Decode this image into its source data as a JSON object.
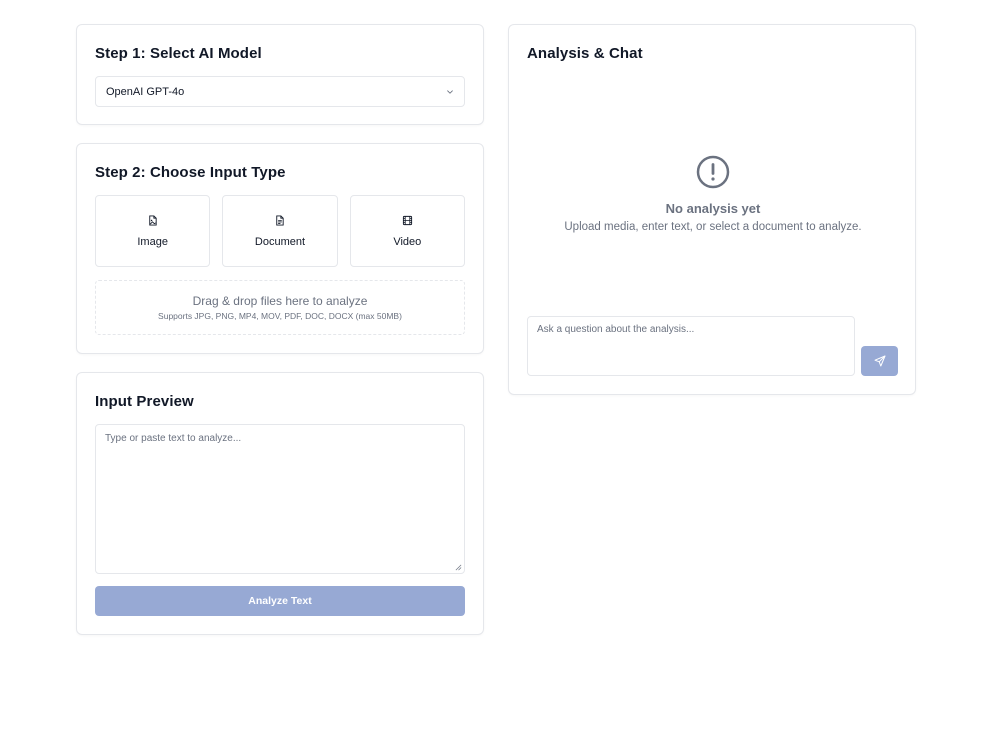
{
  "step1": {
    "title": "Step 1: Select AI Model",
    "selected_model": "OpenAI GPT-4o"
  },
  "step2": {
    "title": "Step 2: Choose Input Type",
    "types": [
      {
        "label": "Image",
        "icon": "image-file-icon"
      },
      {
        "label": "Document",
        "icon": "document-icon"
      },
      {
        "label": "Video",
        "icon": "film-icon"
      }
    ],
    "dropzone": {
      "main": "Drag & drop files here to analyze",
      "sub": "Supports JPG, PNG, MP4, MOV, PDF, DOC, DOCX (max 50MB)"
    }
  },
  "preview": {
    "title": "Input Preview",
    "textarea_placeholder": "Type or paste text to analyze...",
    "analyze_label": "Analyze Text"
  },
  "chat": {
    "title": "Analysis & Chat",
    "empty_icon": "alert-circle-icon",
    "empty_title": "No analysis yet",
    "empty_sub": "Upload media, enter text, or select a document to analyze.",
    "input_placeholder": "Ask a question about the analysis...",
    "send_icon": "send-icon"
  },
  "colors": {
    "accent_disabled": "#97a9d4",
    "border": "#e5e7eb",
    "muted_text": "#6b7280"
  }
}
